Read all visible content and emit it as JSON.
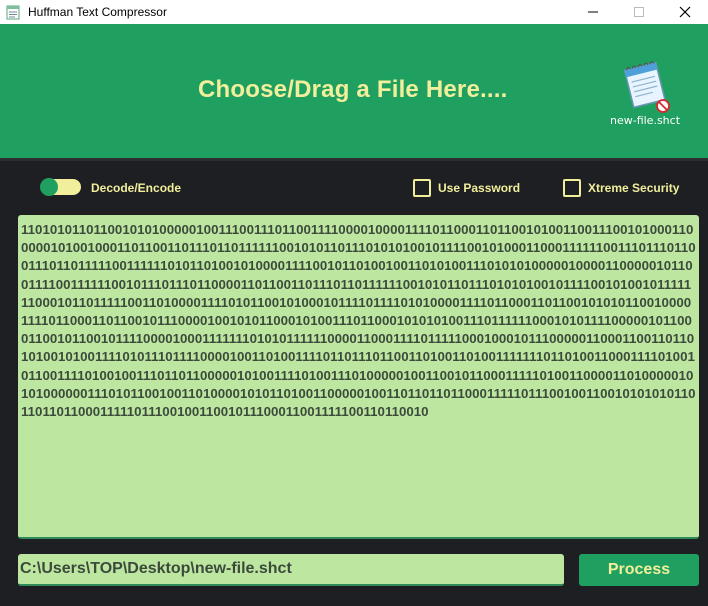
{
  "window": {
    "title": "Huffman Text Compressor",
    "controls": {
      "minimize_icon": "minimize-icon",
      "maximize_icon": "maximize-icon",
      "close_icon": "close-icon"
    }
  },
  "dropzone": {
    "prompt": "Choose/Drag a File Here....",
    "file_icon": "notepad-file-icon",
    "file_name": "new-file.shct"
  },
  "options": {
    "toggle": {
      "label": "Decode/Encode",
      "on": true
    },
    "use_password": {
      "label": "Use Password",
      "checked": false
    },
    "xtreme_security": {
      "label": "Xtreme Security",
      "checked": false
    }
  },
  "output": {
    "binary": "1101010110110010101000001001110011101100111100001000011110110001101100101001100111001010001100000101001000110110011011101101111110010101101110101010010111100101000110001111110011101110110011101101111100111111010110100101000011110010110100100110101001110101010000010000110000010110011110011111100101110111011000011011001101110110111111001010110111010101001011110010100101111111000101101111100110100001111010110010100010111101111010100001111011000110110010101011001000011110110001101100101110000100101011000101001110110001010101001110111111000101011110000010110001100101100101111000010001111111010101111110000110001111011111000100010111000001100011001101101010010100111101011101111000010011010011110110111011001101001101001111111011010011000111101001011001111010010011101101100000101001111010011101000001001100101100011111010011000011010000010101000000111010110010011010000101011010011000001001101101101100011111011100100110010101010110110110110001111101110010011001011100011001111100110110010",
    "path": "C:\\Users\\TOP\\Desktop\\new-file.shct",
    "process_label": "Process"
  },
  "colors": {
    "accent_green": "#20a060",
    "text_yellow": "#f1ef9c",
    "field_bg": "#bde7a0",
    "window_bg": "#1e1f22"
  }
}
